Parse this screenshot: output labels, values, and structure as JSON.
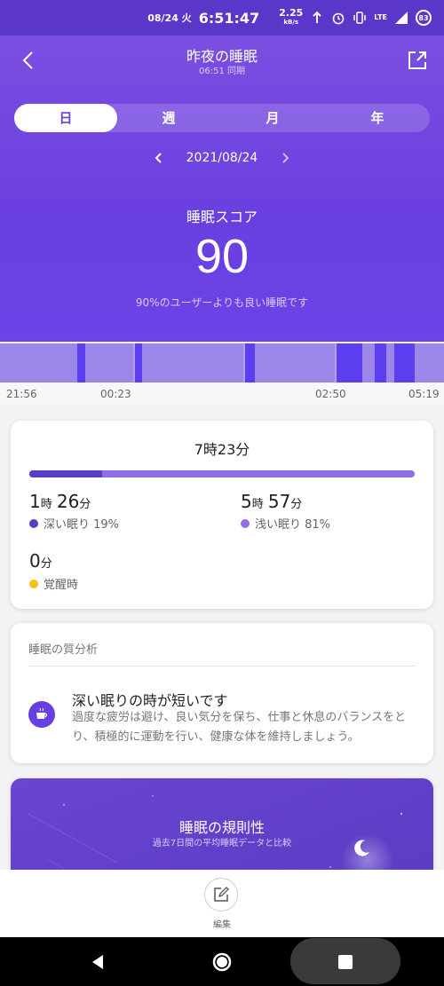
{
  "status_bar": {
    "date": "08/24 火",
    "time": "6:51:47",
    "net_speed": "2.25",
    "net_unit": "kB/s",
    "network_type": "LTE",
    "battery": "83",
    "icons": [
      "upload-arrow-icon",
      "alarm-icon",
      "vibrate-icon",
      "signal-icon",
      "battery-icon"
    ]
  },
  "header": {
    "title": "昨夜の睡眠",
    "sync": "06:51 同期",
    "tabs": [
      "日",
      "週",
      "月",
      "年"
    ],
    "active_tab": "日",
    "date": "2021/08/24",
    "score_label": "睡眠スコア",
    "score": "90",
    "score_desc": "90%のユーザーよりも良い睡眠です"
  },
  "timeline": {
    "labels": [
      "21:56",
      "00:23",
      "02:50",
      "05:19"
    ],
    "colors": {
      "light": "#9d86ea",
      "deep": "#5c3ff0"
    }
  },
  "summary": {
    "total": "7時23分",
    "deep_fraction": 0.19,
    "deep": {
      "hours": "1",
      "hour_unit": "時",
      "minutes": "26",
      "minute_unit": "分",
      "label": "深い眠り 19%",
      "color": "#5b3cc4"
    },
    "light": {
      "hours": "5",
      "hour_unit": "時",
      "minutes": "57",
      "minute_unit": "分",
      "label": "浅い眠り 81%",
      "color": "#8f6ee6"
    },
    "awake": {
      "minutes": "0",
      "minute_unit": "分",
      "label": "覚醒時",
      "color": "#f4c20d"
    }
  },
  "analysis": {
    "section_title": "睡眠の質分析",
    "tip_title": "深い眠りの時が短いです",
    "tip_text": "過度な疲労は避け、良い気分を保ち、仕事と休息のバランスをとり、積極的に運動を行い、健康な体を維持しましょう。",
    "tip_icon": "coffee-cup-icon"
  },
  "regularity": {
    "title": "睡眠の規則性",
    "subtitle": "過去7日間の平均睡眠データと比較"
  },
  "bottom": {
    "edit_label": "編集"
  }
}
